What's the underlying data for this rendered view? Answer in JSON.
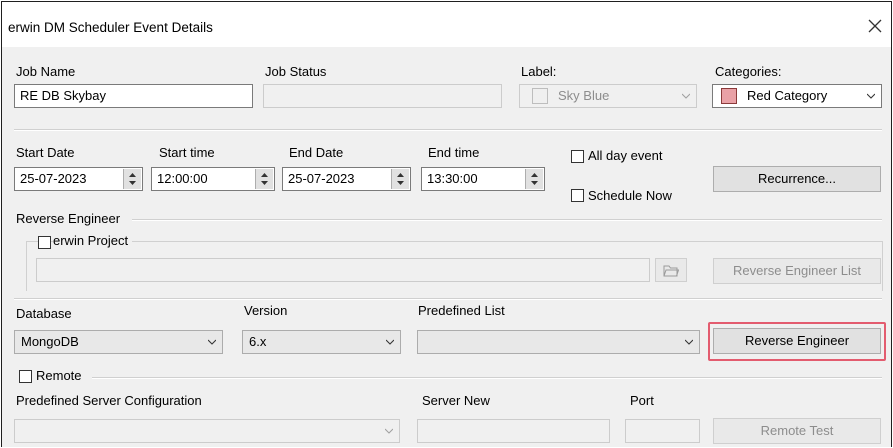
{
  "window": {
    "title": "erwin DM Scheduler Event Details"
  },
  "job": {
    "name_label": "Job Name",
    "name_value": "RE DB Skybay",
    "status_label": "Job Status",
    "status_value": "",
    "label_label": "Label:",
    "label_value": "Sky Blue",
    "categories_label": "Categories:",
    "categories_value": "Red Category",
    "category_color": "#e9a1a6"
  },
  "schedule": {
    "start_date_label": "Start Date",
    "start_date_value": "25-07-2023",
    "start_time_label": "Start time",
    "start_time_value": "12:00:00",
    "end_date_label": "End Date",
    "end_date_value": "25-07-2023",
    "end_time_label": "End time",
    "end_time_value": "13:30:00",
    "all_day_label": "All day event",
    "schedule_now_label": "Schedule Now",
    "recurrence_label": "Recurrence..."
  },
  "reverse_engineer": {
    "section_label": "Reverse Engineer",
    "erwin_project_label": "erwin Project",
    "project_path_value": "",
    "list_button_label": "Reverse Engineer List"
  },
  "database": {
    "database_label": "Database",
    "database_value": "MongoDB",
    "version_label": "Version",
    "version_value": "6.x",
    "predefined_list_label": "Predefined List",
    "predefined_list_value": "",
    "reverse_engineer_button_label": "Reverse Engineer",
    "highlight_color": "#e35c6f"
  },
  "remote": {
    "remote_label": "Remote",
    "predefined_server_label": "Predefined Server Configuration",
    "server_new_label": "Server New",
    "port_label": "Port",
    "remote_test_label": "Remote Test"
  }
}
